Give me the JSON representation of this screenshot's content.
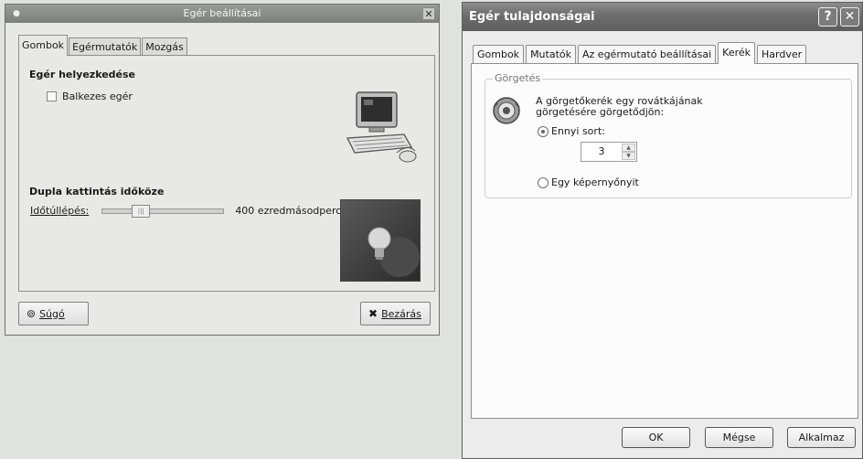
{
  "gnome_dialog": {
    "title": "Egér beállításai",
    "tabs": [
      {
        "label": "Gombok",
        "active": true
      },
      {
        "label": "Egérmutatók",
        "active": false
      },
      {
        "label": "Mozgás",
        "active": false
      }
    ],
    "mouse_orientation": {
      "heading": "Egér helyezkedése",
      "left_handed_checkbox": {
        "label": "Balkezes egér",
        "checked": false
      }
    },
    "double_click": {
      "heading": "Dupla kattintás időköze",
      "timeout_label": "Időtúllépés:",
      "timeout_value_text": "400 ezredmásodperc"
    },
    "help_button": {
      "label": "Súgó",
      "icon": "help-icon"
    },
    "close_button": {
      "label": "Bezárás",
      "icon": "close-x-icon"
    }
  },
  "xp_dialog": {
    "title": "Egér tulajdonságai",
    "title_buttons": {
      "help": "?",
      "close": "✕"
    },
    "tabs": [
      {
        "label": "Gombok",
        "active": false
      },
      {
        "label": "Mutatók",
        "active": false
      },
      {
        "label": "Az egérmutató beállításai",
        "active": false
      },
      {
        "label": "Kerék",
        "active": true
      },
      {
        "label": "Hardver",
        "active": false
      }
    ],
    "scrolling": {
      "group_label": "Görgetés",
      "description_line1": "A görgetőkerék egy rovátkájának",
      "description_line2": "görgetésére görgetődjön:",
      "option_lines": {
        "label": "Ennyi sort:",
        "selected": true
      },
      "lines_value": "3",
      "option_screen": {
        "label": "Egy képernyőnyit",
        "selected": false
      }
    },
    "buttons": {
      "ok": "OK",
      "cancel": "Mégse",
      "apply": "Alkalmaz"
    }
  }
}
